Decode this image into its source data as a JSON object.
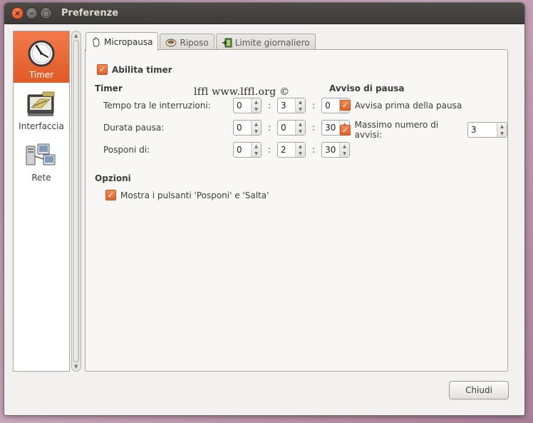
{
  "window": {
    "title": "Preferenze",
    "close_glyph": "×",
    "min_glyph": "–",
    "max_glyph": "□"
  },
  "sidebar": {
    "items": [
      {
        "label": "Timer",
        "icon": "clock-icon",
        "selected": true
      },
      {
        "label": "Interfaccia",
        "icon": "interface-icon",
        "selected": false
      },
      {
        "label": "Rete",
        "icon": "network-icon",
        "selected": false
      }
    ]
  },
  "tabs": [
    {
      "label": "Micropausa",
      "icon": "hand-icon",
      "active": true
    },
    {
      "label": "Riposo",
      "icon": "cup-icon",
      "active": false
    },
    {
      "label": "Limite giornaliero",
      "icon": "exit-icon",
      "active": false
    }
  ],
  "watermark": "lffl www.lffl.org ©",
  "main": {
    "enable_timer": {
      "label": "Abilita timer",
      "checked": true
    },
    "timer_heading": "Timer",
    "timer_rows": [
      {
        "label": "Tempo tra le interruzioni:",
        "h": "0",
        "m": "3",
        "s": "0"
      },
      {
        "label": "Durata pausa:",
        "h": "0",
        "m": "0",
        "s": "30"
      },
      {
        "label": "Posponi di:",
        "h": "0",
        "m": "2",
        "s": "30"
      }
    ],
    "separator": ":",
    "notice_heading": "Avviso di pausa",
    "warn_before": {
      "label": "Avvisa prima della pausa",
      "checked": true
    },
    "max_warnings": {
      "label": "Massimo numero di avvisi:",
      "checked": true,
      "value": "3"
    },
    "options_heading": "Opzioni",
    "show_buttons": {
      "label": "Mostra i pulsanti 'Posponi' e 'Salta'",
      "checked": true
    }
  },
  "footer": {
    "close_label": "Chiudi"
  },
  "colors": {
    "accent": "#e9672f",
    "titlebar": "#3c3b37",
    "window_bg": "#f2f1f0"
  }
}
